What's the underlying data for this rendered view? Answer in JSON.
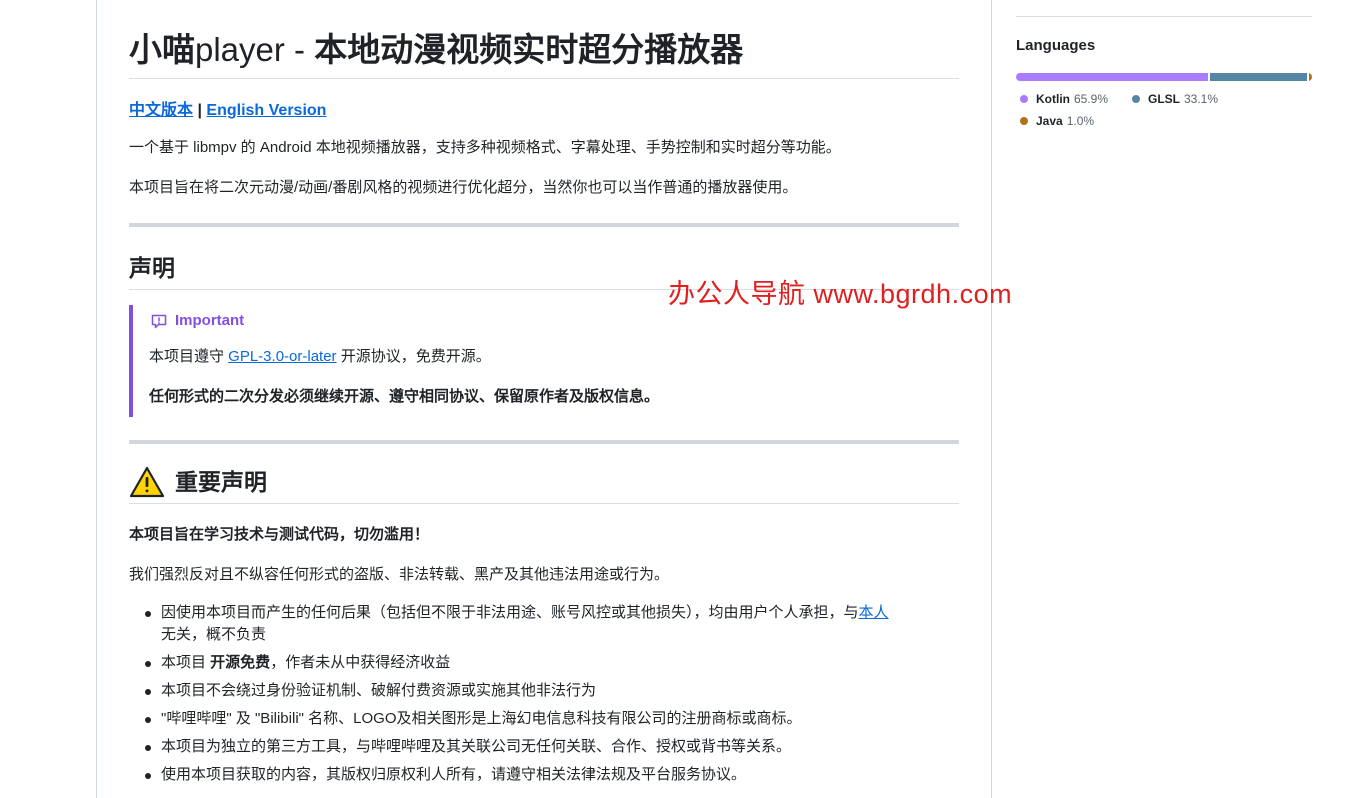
{
  "readme": {
    "title_prefix": "小喵",
    "title_latin": "player - ",
    "title_suffix": "本地动漫视频实时超分播放器",
    "lang_link_cn": "中文版本",
    "lang_sep": "|",
    "lang_link_en": "English Version",
    "intro1": "一个基于 libmpv 的 Android 本地视频播放器，支持多种视频格式、字幕处理、手势控制和实时超分等功能。",
    "intro2": "本项目旨在将二次元动漫/动画/番剧风格的视频进行优化超分，当然你也可以当作普通的播放器使用。",
    "section1_title": "声明",
    "alert_title": "Important",
    "alert_line1_pre": "本项目遵守 ",
    "alert_line1_link": "GPL-3.0-or-later",
    "alert_line1_post": " 开源协议，免费开源。",
    "alert_line2": "任何形式的二次分发必须继续开源、遵守相同协议、保留原作者及版权信息。",
    "section2_title": "重要声明",
    "warn_bold": "本项目旨在学习技术与测试代码，切勿滥用！",
    "warn_para": "我们强烈反对且不纵容任何形式的盗版、非法转载、黑产及其他违法用途或行为。",
    "bullet1_text": "因使用本项目而产生的任何后果（包括但不限于非法用途、账号风控或其他损失），均由用户个人承担，与",
    "bullet1_link": "本人",
    "bullet1_tail": "无关，概不负责",
    "bullet2_pre": "本项目 ",
    "bullet2_bold": "开源免费",
    "bullet2_post": "，作者未从中获得经济收益",
    "bullet3": "本项目不会绕过身份验证机制、破解付费资源或实施其他非法行为",
    "bullet4": "\"哔哩哔哩\" 及 \"Bilibili\" 名称、LOGO及相关图形是上海幻电信息科技有限公司的注册商标或商标。",
    "bullet5": "本项目为独立的第三方工具，与哔哩哔哩及其关联公司无任何关联、合作、授权或背书等关系。",
    "bullet6": "使用本项目获取的内容，其版权归原权利人所有，请遵守相关法律法规及平台服务协议。"
  },
  "watermark": "办公人导航  www.bgrdh.com",
  "sidebar": {
    "languages_title": "Languages",
    "languages": [
      {
        "name": "Kotlin",
        "percent": "65.9%",
        "value": 65.9,
        "color": "#A97BFF"
      },
      {
        "name": "GLSL",
        "percent": "33.1%",
        "value": 33.1,
        "color": "#5686a5"
      },
      {
        "name": "Java",
        "percent": "1.0%",
        "value": 1.0,
        "color": "#b07219"
      }
    ]
  }
}
